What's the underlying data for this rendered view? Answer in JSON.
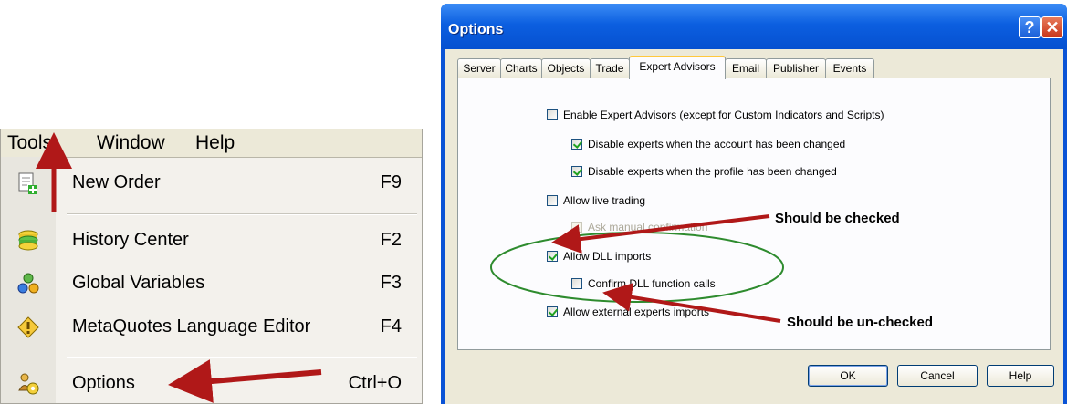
{
  "menu": {
    "bar": {
      "tools": "Tools",
      "window": "Window",
      "help": "Help"
    },
    "items": [
      {
        "label": "New Order",
        "shortcut": "F9",
        "icon": "new-order-icon"
      },
      {
        "label": "History Center",
        "shortcut": "F2",
        "icon": "history-center-icon"
      },
      {
        "label": "Global Variables",
        "shortcut": "F3",
        "icon": "global-variables-icon"
      },
      {
        "label": "MetaQuotes Language Editor",
        "shortcut": "F4",
        "icon": "metaquotes-editor-icon"
      },
      {
        "label": "Options",
        "shortcut": "Ctrl+O",
        "icon": "options-icon"
      }
    ]
  },
  "dialog": {
    "title": "Options",
    "help_glyph": "?",
    "close_glyph": "✕",
    "tabs": [
      "Server",
      "Charts",
      "Objects",
      "Trade",
      "Expert Advisors",
      "Email",
      "Publisher",
      "Events"
    ],
    "active_tab": "Expert Advisors",
    "options": {
      "enable_experts": "Enable Expert Advisors (except for Custom Indicators and Scripts)",
      "disable_account": "Disable experts when the account has been changed",
      "disable_profile": "Disable experts when the profile has been changed",
      "live_trading": "Allow live trading",
      "manual_confirm": "Ask manual confirmation",
      "dll_imports": "Allow DLL imports",
      "confirm_dll": "Confirm DLL function calls",
      "external_imports": "Allow external experts imports"
    },
    "buttons": {
      "ok": "OK",
      "cancel": "Cancel",
      "help": "Help"
    }
  },
  "annotations": {
    "checked": "Should be checked",
    "unchecked": "Should be un-checked"
  },
  "colors": {
    "arrow": "#b01818",
    "ellipse": "#2e8b2e",
    "titlebar": "#0c5fe0"
  }
}
